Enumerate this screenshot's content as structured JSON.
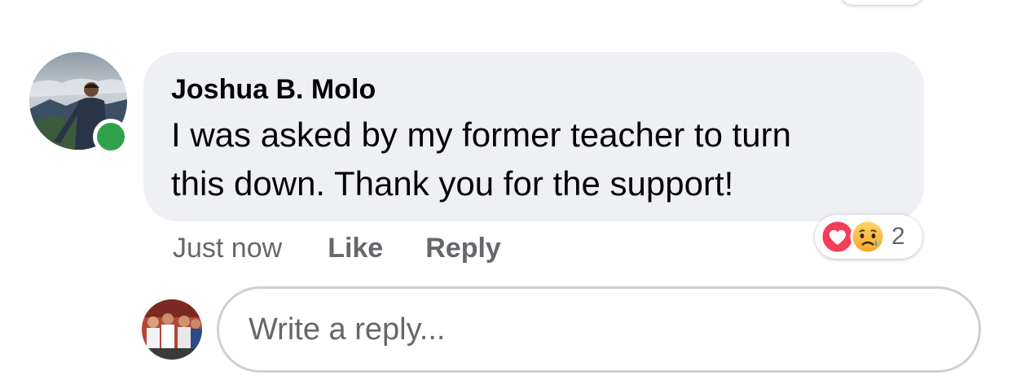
{
  "comment": {
    "author": "Joshua B. Molo",
    "text_line1": "I was asked by my former teacher to turn",
    "text_line2": "this down. Thank you for the support!",
    "timestamp": "Just now",
    "like_label": "Like",
    "reply_label": "Reply",
    "online": true,
    "reactions": {
      "icons": [
        "heart-reaction-icon",
        "sad-reaction-icon"
      ],
      "count": "2"
    }
  },
  "reply_box": {
    "placeholder": "Write a reply..."
  },
  "colors": {
    "bubble": "#eff0f4",
    "online": "#31a24c",
    "heart": "#f33e58",
    "sad": "#f7b125",
    "secondary_text": "#65676b"
  }
}
